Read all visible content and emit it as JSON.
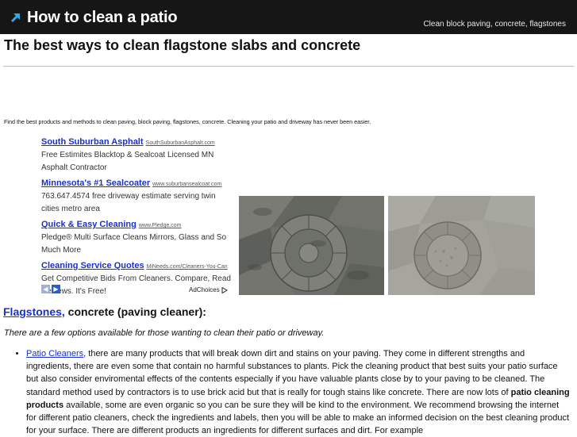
{
  "header": {
    "title": "How to clean a patio",
    "tagline": "Clean block paving, concrete, flagstones",
    "arrow_icon": "arrow-up-right-icon",
    "bg_color": "#161616",
    "accent_color": "#35a6e8"
  },
  "page": {
    "heading": "The best ways to clean flagstone slabs and concrete",
    "intro": "Find the best products and methods to clean paving, block paving, flagstones, concrete. Cleaning your patio and driveway has never been easier."
  },
  "ads": {
    "items": [
      {
        "title": "South Suburban Asphalt",
        "url": "SouthSuburbanAsphalt.com",
        "desc": "Free Estimites Blacktop & Sealcoat Licensed MN Asphalt Contractor"
      },
      {
        "title": "Minnesota's #1 Sealcoater",
        "url": "www.suburbansealcoat.com",
        "desc": "763.647.4574 free driveway estimate serving twin cities metro area"
      },
      {
        "title": "Quick & Easy Cleaning",
        "url": "www.Pledge.com",
        "desc": "Pledge® Multi Surface Cleans Mirrors, Glass and So Much More"
      },
      {
        "title": "Cleaning Service Quotes",
        "url": "MiNeeds.com/Cleaners-You-Can",
        "desc": "Get Competitive Bids From Cleaners. Compare, Read Reviews. It's Free!"
      }
    ],
    "prev_icon": "chevron-left-icon",
    "next_icon": "chevron-right-icon",
    "adchoices_label": "AdChoices",
    "adchoices_icon": "adchoices-icon",
    "link_color": "#1a2fd0"
  },
  "section": {
    "heading_link": "Flagstones,",
    "heading_rest": " concrete (paving cleaner):",
    "lead": "There are a few options available for those wanting to clean their patio or driveway.",
    "bullet": {
      "link": "Patio Cleaners",
      "text1": ", there are many products that will break down dirt and stains on your paving. They come in different strengths and ingredients, there are even some that contain no harmful substances to plants. Pick the cleaning product that best suits your patio surface but also consider enviromental effects of the contents especially if you have valuable plants close by to your paving to be cleaned. The standard method used by contractors is to use brick acid but that is really for tough stains like concrete. There are now lots of ",
      "bold": "patio cleaning products",
      "text2": " available, some are even organic so you can be sure they will be kind to the environment. We recommend browsing the internet for different patio cleaners, check the ingredients and labels, then you will be able to make an informed decision on the best cleaning product for your surface. There are different products an ingredients for different surfaces and dirt. For example"
    }
  }
}
